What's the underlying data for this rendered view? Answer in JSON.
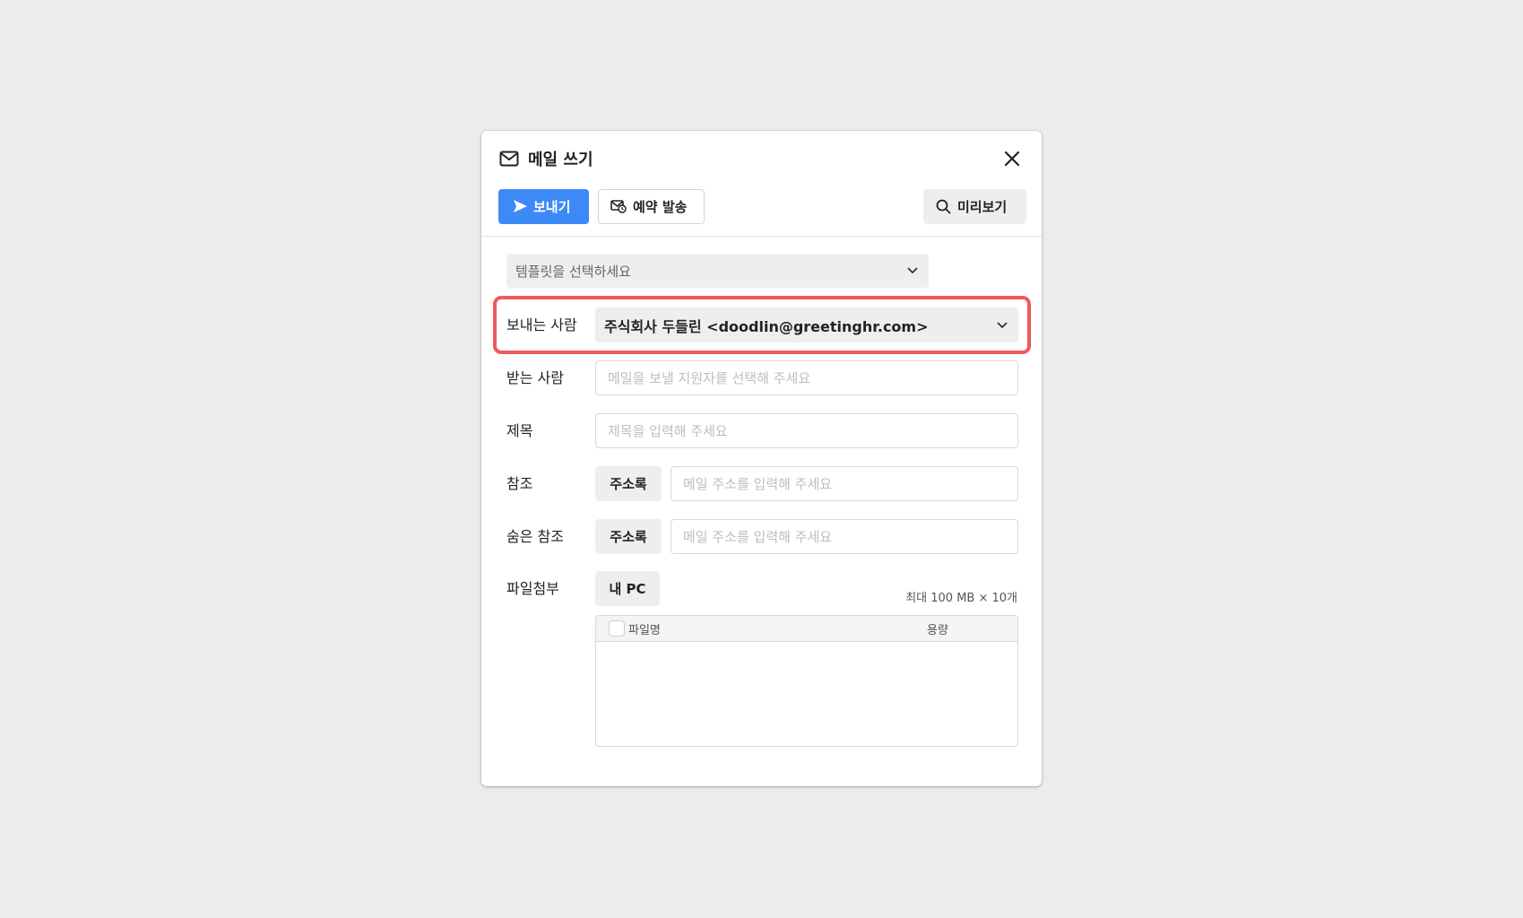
{
  "modal": {
    "title": "메일 쓰기",
    "toolbar": {
      "send_label": "보내기",
      "schedule_label": "예약 발송",
      "preview_label": "미리보기"
    },
    "template_select": {
      "placeholder": "템플릿을 선택하세요"
    },
    "sender": {
      "label": "보내는 사람",
      "value": "주식회사 두들린 <doodlin@greetinghr.com>"
    },
    "recipient": {
      "label": "받는 사람",
      "placeholder": "메일을 보낼 지원자를 선택해 주세요"
    },
    "subject": {
      "label": "제목",
      "placeholder": "제목을 입력해 주세요"
    },
    "cc": {
      "label": "참조",
      "address_book_label": "주소록",
      "placeholder": "메일 주소를 입력해 주세요"
    },
    "bcc": {
      "label": "숨은 참조",
      "address_book_label": "주소록",
      "placeholder": "메일 주소를 입력해 주세요"
    },
    "attachment": {
      "label": "파일첨부",
      "my_pc_label": "내 PC",
      "limit_text": "최대 100 MB × 10개",
      "columns": {
        "name": "파일명",
        "size": "용량"
      },
      "files": []
    }
  },
  "colors": {
    "primary": "#3d8af7",
    "highlight": "#ef5b5b",
    "background": "#ececec"
  },
  "icons": {
    "title": "mail-icon",
    "close": "close-icon",
    "send": "send-arrow-icon",
    "schedule": "scheduled-mail-icon",
    "preview": "search-icon",
    "dropdown": "chevron-down-icon"
  }
}
